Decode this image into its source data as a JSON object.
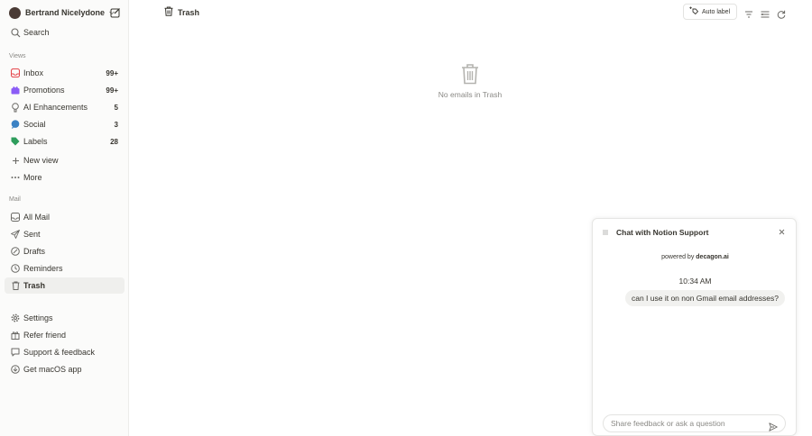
{
  "account": {
    "name": "Bertrand Nicelydone"
  },
  "search": {
    "label": "Search"
  },
  "views": {
    "section_label": "Views",
    "items": [
      {
        "label": "Inbox",
        "count": "99+",
        "icon": "inbox-icon",
        "color": "#e5484d"
      },
      {
        "label": "Promotions",
        "count": "99+",
        "icon": "promotions-icon",
        "color": "#8b5cf6"
      },
      {
        "label": "AI Enhancements",
        "count": "5",
        "icon": "lightbulb-icon",
        "color": "#6b6a66"
      },
      {
        "label": "Social",
        "count": "3",
        "icon": "social-icon",
        "color": "#3b82c4"
      },
      {
        "label": "Labels",
        "count": "28",
        "icon": "tag-icon",
        "color": "#2e9d5c"
      },
      {
        "label": "New view",
        "count": "",
        "icon": "plus-icon",
        "color": "#6b6a66"
      },
      {
        "label": "More",
        "count": "",
        "icon": "more-icon",
        "color": "#6b6a66"
      }
    ]
  },
  "mail": {
    "section_label": "Mail",
    "items": [
      {
        "label": "All Mail",
        "icon": "all-mail-icon"
      },
      {
        "label": "Sent",
        "icon": "sent-icon"
      },
      {
        "label": "Drafts",
        "icon": "drafts-icon"
      },
      {
        "label": "Reminders",
        "icon": "reminders-icon"
      },
      {
        "label": "Trash",
        "icon": "trash-icon",
        "active": true
      }
    ]
  },
  "footer_items": [
    {
      "label": "Settings",
      "icon": "gear-icon"
    },
    {
      "label": "Refer friend",
      "icon": "gift-icon"
    },
    {
      "label": "Support & feedback",
      "icon": "chat-bubble-icon"
    },
    {
      "label": "Get macOS app",
      "icon": "download-icon"
    }
  ],
  "header": {
    "title": "Trash",
    "auto_label": "Auto label"
  },
  "empty_state": {
    "text": "No emails in Trash"
  },
  "chat": {
    "title": "Chat with Notion Support",
    "powered_prefix": "powered by",
    "powered_brand": "decagon.ai",
    "time": "10:34 AM",
    "message": "can I use it on non Gmail email addresses?",
    "input_placeholder": "Share feedback or ask a question"
  },
  "colors": {
    "sidebar_bg": "#fbfbfa",
    "text": "#37352f",
    "muted": "#8a8985",
    "active_row": "#efefed"
  }
}
